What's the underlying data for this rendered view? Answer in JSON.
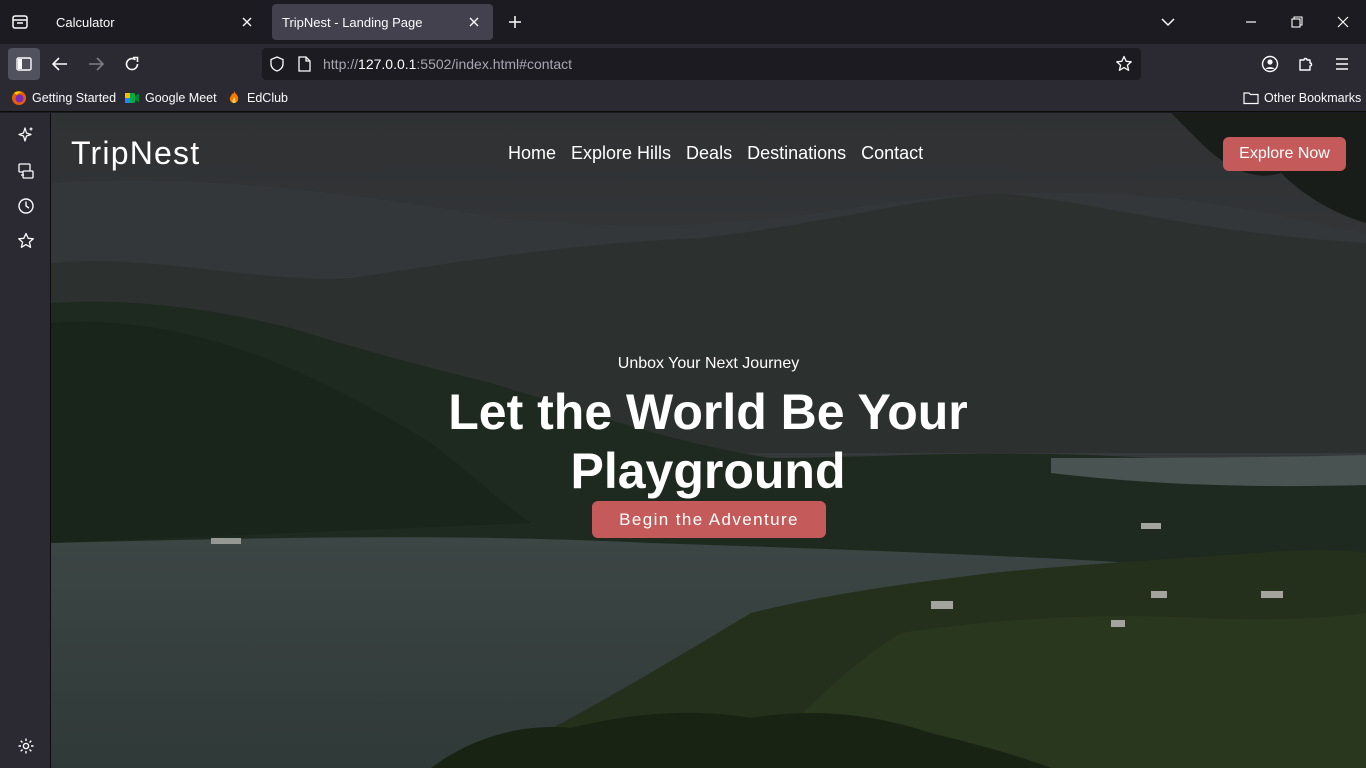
{
  "browser": {
    "tabs": [
      {
        "title": "Calculator",
        "active": false
      },
      {
        "title": "TripNest - Landing Page",
        "active": true
      }
    ],
    "url": {
      "protocol": "http://",
      "host": "127.0.0.1",
      "rest": ":5502/index.html#contact"
    },
    "bookmarks": [
      {
        "label": "Getting Started",
        "icon": "firefox-icon"
      },
      {
        "label": "Google Meet",
        "icon": "google-meet-icon"
      },
      {
        "label": "EdClub",
        "icon": "edclub-icon"
      }
    ],
    "other_bookmarks": "Other Bookmarks"
  },
  "site": {
    "logo": "TripNest",
    "nav": [
      "Home",
      "Explore Hills",
      "Deals",
      "Destinations",
      "Contact"
    ],
    "cta": "Explore Now",
    "hero": {
      "subtitle": "Unbox Your Next Journey",
      "title": "Let the World Be Your Playground",
      "button": "Begin the Adventure"
    }
  },
  "colors": {
    "browser_bg": "#1c1b22",
    "toolbar_bg": "#2b2a33",
    "active_tab": "#42414d",
    "accent_button": "#c45a5a"
  }
}
